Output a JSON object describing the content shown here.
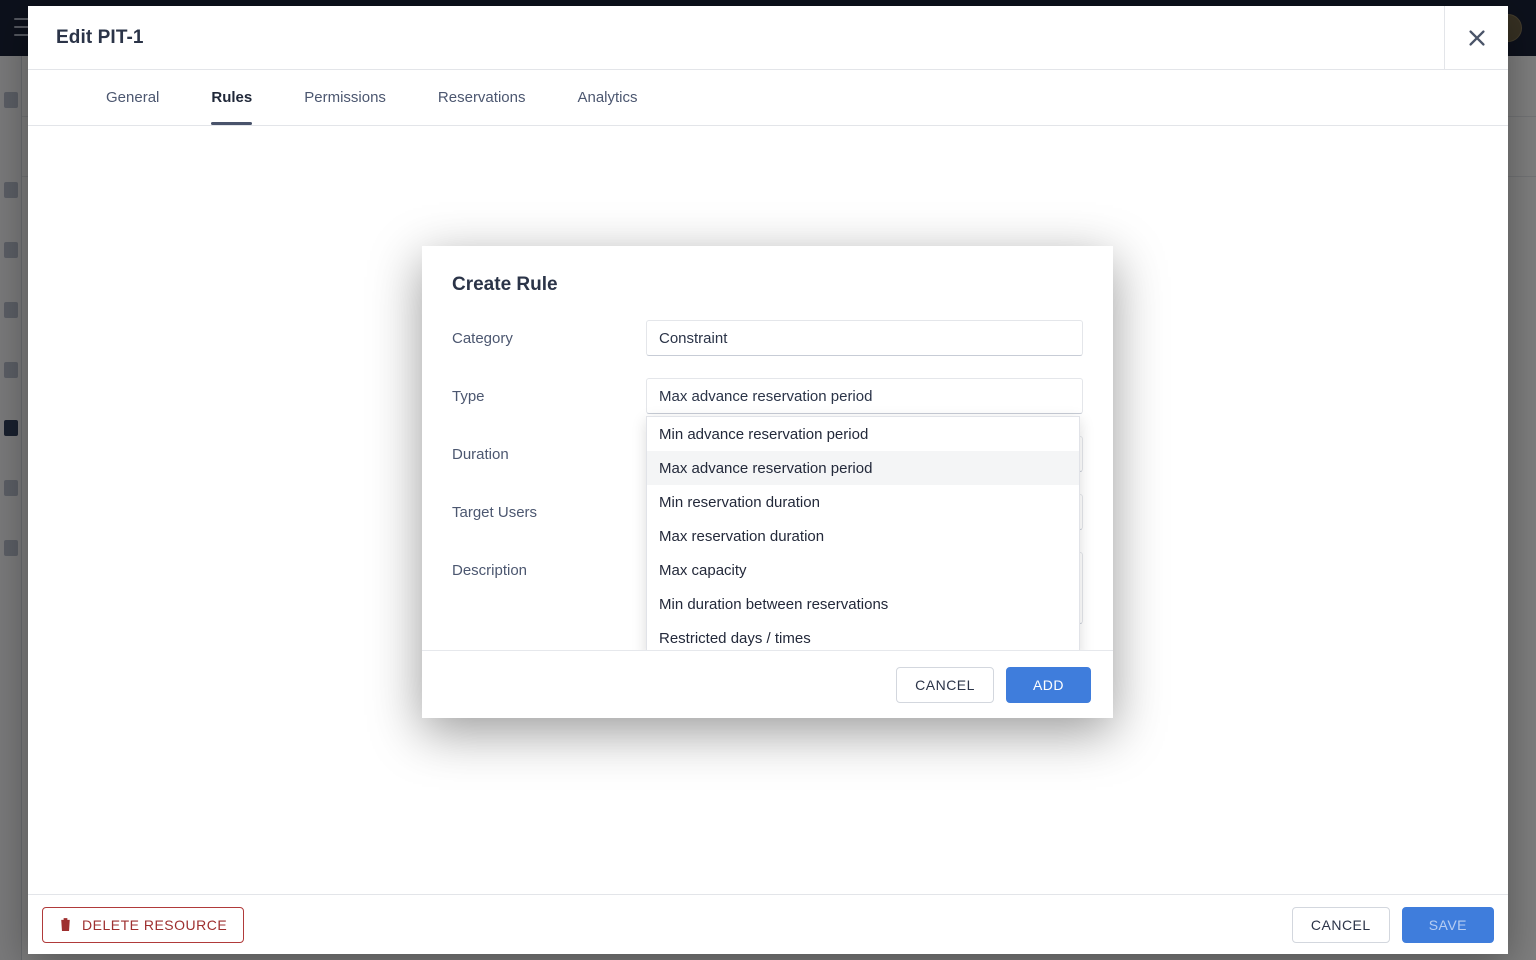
{
  "app": {
    "menu_icon": "hamburger-icon",
    "avatar_icon": "user-avatar"
  },
  "panel": {
    "title": "Edit PIT-1",
    "close_icon": "close-icon",
    "tabs": [
      {
        "label": "General",
        "active": false
      },
      {
        "label": "Rules",
        "active": true
      },
      {
        "label": "Permissions",
        "active": false
      },
      {
        "label": "Reservations",
        "active": false
      },
      {
        "label": "Analytics",
        "active": false
      }
    ],
    "footer": {
      "delete_label": "DELETE RESOURCE",
      "delete_icon": "trash-icon",
      "cancel_label": "CANCEL",
      "save_label": "SAVE",
      "save_disabled": true
    }
  },
  "dialog": {
    "title": "Create Rule",
    "fields": {
      "category_label": "Category",
      "category_value": "Constraint",
      "type_label": "Type",
      "type_value": "Max advance reservation period",
      "duration_label": "Duration",
      "duration_value": "",
      "target_users_label": "Target Users",
      "target_users_value": "",
      "description_label": "Description",
      "description_value": ""
    },
    "dropdown": {
      "open": true,
      "selected": "Max advance reservation period",
      "options": [
        "Min advance reservation period",
        "Max advance reservation period",
        "Min reservation duration",
        "Max reservation duration",
        "Max capacity",
        "Min duration between reservations",
        "Restricted days / times"
      ]
    },
    "footer": {
      "cancel_label": "CANCEL",
      "add_label": "ADD"
    }
  },
  "colors": {
    "primary": "#3f7ddc",
    "navbar": "#1b2338",
    "danger": "#9e2f2f",
    "tab_active_underline": "#49536b"
  }
}
